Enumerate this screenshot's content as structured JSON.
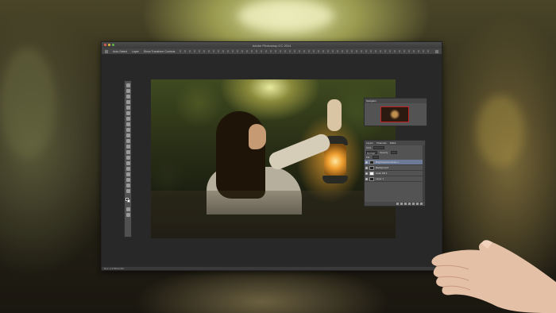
{
  "window": {
    "title": "Adobe Photoshop CC 2014"
  },
  "optionsbar": {
    "auto_select": "Auto-Select",
    "layer": "Layer",
    "transform": "Show Transform Controls"
  },
  "navigator": {
    "tab": "Navigator"
  },
  "layers_panel": {
    "tabs": [
      "Layers",
      "Channels",
      "Paths"
    ],
    "kind": "Kind",
    "blend": "Normal",
    "opacity_label": "Opacity:",
    "fill_label": "Fill:",
    "rows": [
      {
        "name": "Brightness/Contrast 1",
        "selected": true
      },
      {
        "name": "Background",
        "selected": false
      },
      {
        "name": "Color Fill 1",
        "selected": false
      },
      {
        "name": "Layer 1",
        "selected": false
      }
    ]
  },
  "status": {
    "text": "Doc: 2.17M/12.2M"
  },
  "colors": {
    "selection": "#6c7a96",
    "nav_frame": "#c02020"
  }
}
